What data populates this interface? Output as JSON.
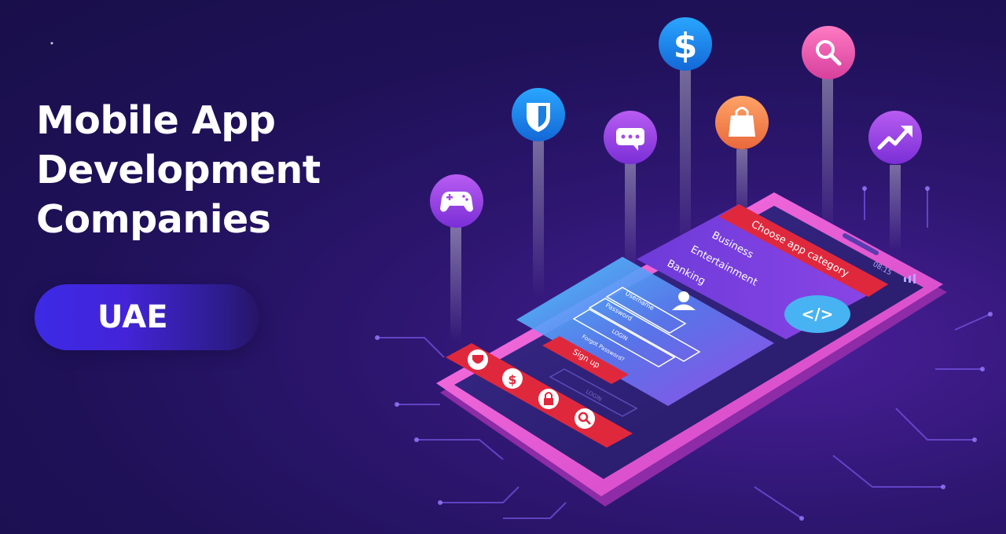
{
  "headline": {
    "lines": [
      "Mobile App",
      "Development",
      "Companies"
    ]
  },
  "badge": {
    "label": "UAE"
  },
  "phone": {
    "category_header": "Choose app category",
    "categories": [
      "Business",
      "Entertainment",
      "Banking"
    ],
    "login": {
      "username_placeholder": "Username",
      "password_placeholder": "Password",
      "login_label": "LOGIN",
      "forgot_label": "Forgot Password?",
      "signup_label": "Sign up"
    },
    "status_time": "08:15",
    "bottom_login_label": "LOGIN"
  },
  "floating_icons": [
    "gamepad-icon",
    "shield-icon",
    "chat-icon",
    "dollar-icon",
    "shopping-bag-icon",
    "search-icon",
    "trend-up-icon"
  ],
  "colors": {
    "background": "#1f1158",
    "accent_pink": "#e34ec9",
    "accent_blue": "#1e8ee8",
    "accent_red": "#e0283c",
    "accent_orange": "#f28b4b",
    "badge_blue": "#3c2ae6"
  }
}
